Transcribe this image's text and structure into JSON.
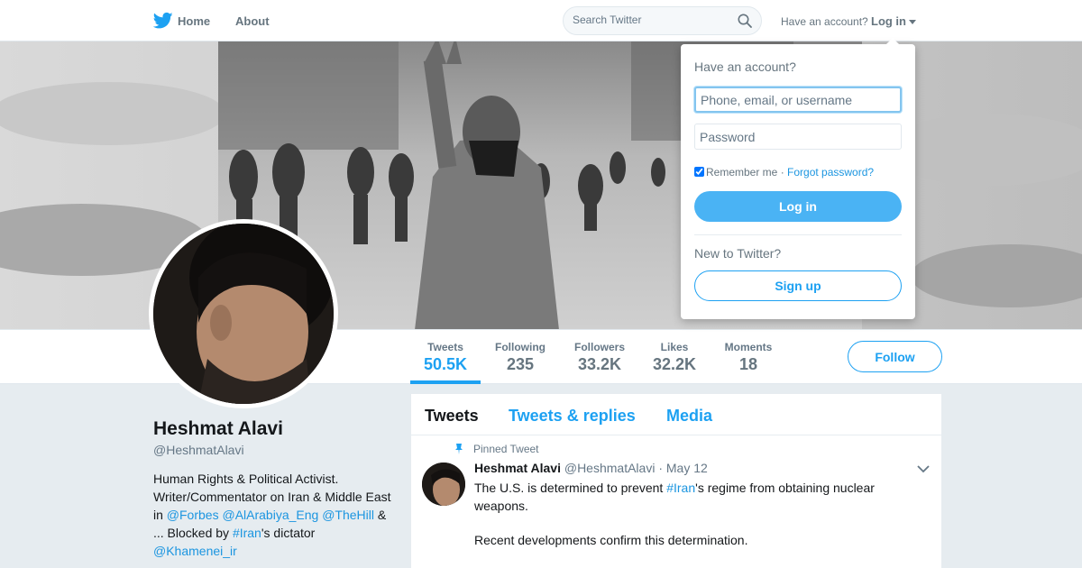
{
  "nav": {
    "logo_icon": "twitter-bird-icon",
    "home_label": "Home",
    "about_label": "About",
    "search_placeholder": "Search Twitter",
    "search_icon": "search-icon",
    "have_account_text": "Have an account?",
    "login_label": "Log in"
  },
  "profile": {
    "name": "Heshmat Alavi",
    "handle": "@HeshmatAlavi",
    "bio": {
      "line1": "Human Rights & Political Activist. Writer/Commentator on Iran & Middle East in ",
      "link1": "@Forbes",
      "link2": "@AlArabiya_Eng",
      "link3": "@TheHill",
      "mid": " & ... Blocked by ",
      "link4": "#Iran",
      "mid2": "'s dictator ",
      "link5": "@Khamenei_ir"
    }
  },
  "stats": [
    {
      "label": "Tweets",
      "value": "50.5K"
    },
    {
      "label": "Following",
      "value": "235"
    },
    {
      "label": "Followers",
      "value": "33.2K"
    },
    {
      "label": "Likes",
      "value": "32.2K"
    },
    {
      "label": "Moments",
      "value": "18"
    }
  ],
  "follow_label": "Follow",
  "timeline": {
    "tabs": [
      "Tweets",
      "Tweets & replies",
      "Media"
    ],
    "pinned_label": "Pinned Tweet",
    "tweet": {
      "name": "Heshmat Alavi",
      "handle": "@HeshmatAlavi",
      "date": "· May 12",
      "text_a": "The U.S. is determined to prevent ",
      "text_link": "#Iran",
      "text_b": "'s regime from obtaining nuclear weapons.",
      "text2": "Recent developments confirm this determination."
    }
  },
  "login_dropdown": {
    "title": "Have an account?",
    "username_placeholder": "Phone, email, or username",
    "password_placeholder": "Password",
    "remember_label": "Remember me",
    "separator": " · ",
    "forgot_label": "Forgot password?",
    "login_button": "Log in",
    "new_to": "New to Twitter?",
    "signup_button": "Sign up"
  },
  "colors": {
    "accent": "#1da1f2",
    "login_button_bg": "#4ab3f4",
    "link": "#1b95e0",
    "background": "#e6ecf0"
  }
}
